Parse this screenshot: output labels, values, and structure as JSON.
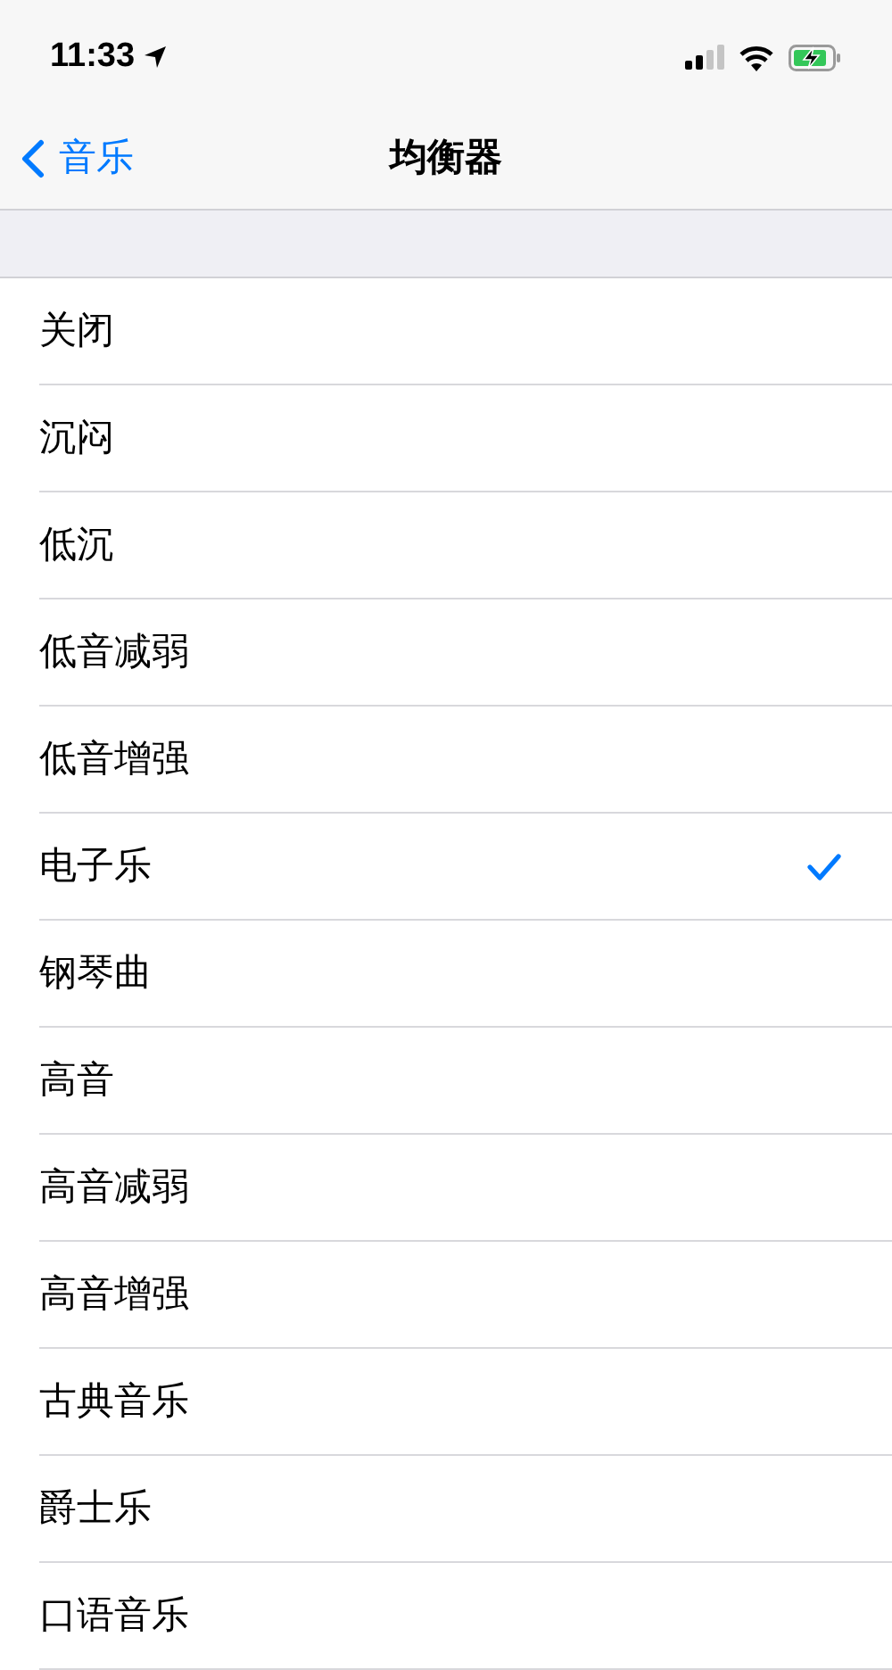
{
  "status_bar": {
    "time": "11:33"
  },
  "nav": {
    "back_label": "音乐",
    "title": "均衡器"
  },
  "options": [
    {
      "label": "关闭",
      "selected": false
    },
    {
      "label": "沉闷",
      "selected": false
    },
    {
      "label": "低沉",
      "selected": false
    },
    {
      "label": "低音减弱",
      "selected": false
    },
    {
      "label": "低音增强",
      "selected": false
    },
    {
      "label": "电子乐",
      "selected": true
    },
    {
      "label": "钢琴曲",
      "selected": false
    },
    {
      "label": "高音",
      "selected": false
    },
    {
      "label": "高音减弱",
      "selected": false
    },
    {
      "label": "高音增强",
      "selected": false
    },
    {
      "label": "古典音乐",
      "selected": false
    },
    {
      "label": "爵士乐",
      "selected": false
    },
    {
      "label": "口语音乐",
      "selected": false
    }
  ]
}
